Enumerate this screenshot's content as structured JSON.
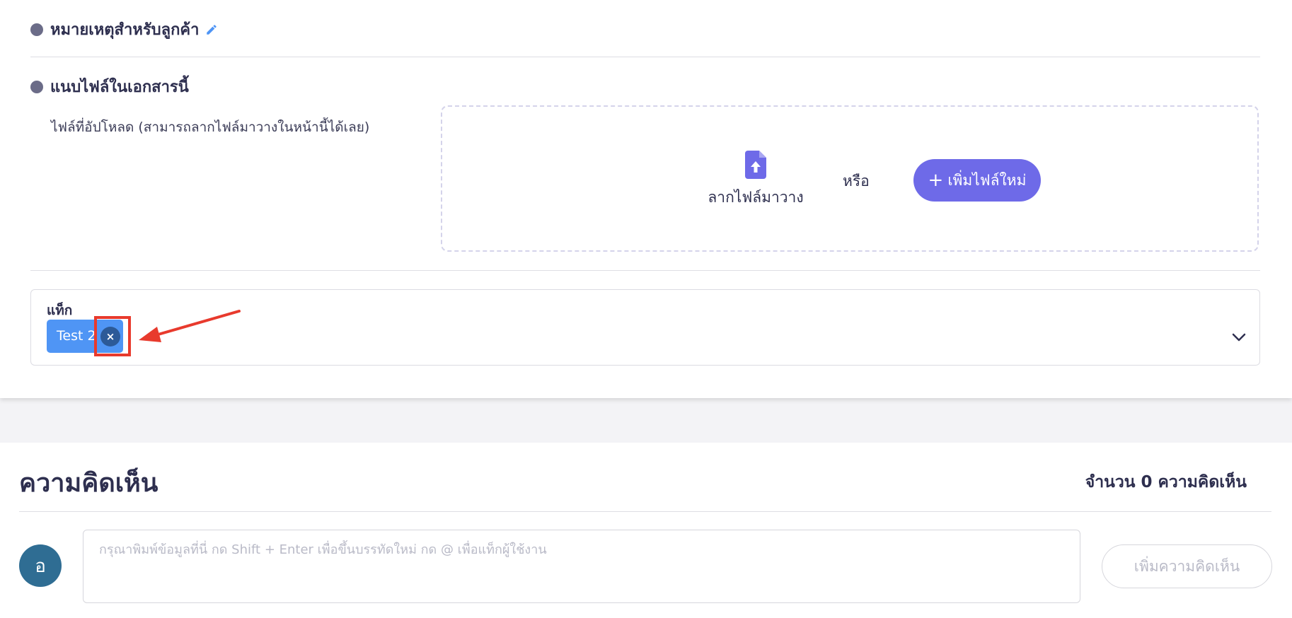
{
  "sections": {
    "customer_note": {
      "title": "หมายเหตุสำหรับลูกค้า"
    },
    "attachments": {
      "title": "แนบไฟล์ในเอกสารนี้",
      "hint": "ไฟล์ที่อัปโหลด (สามารถลากไฟล์มาวางในหน้านี้ได้เลย)",
      "drag_label": "ลากไฟล์มาวาง",
      "or_label": "หรือ",
      "add_file_label": "เพิ่มไฟล์ใหม่"
    },
    "tags": {
      "label": "แท็ก",
      "items": [
        {
          "label": "Test 2"
        }
      ]
    }
  },
  "comments": {
    "title": "ความคิดเห็น",
    "count_text": "จำนวน 0 ความคิดเห็น",
    "avatar_initial": "อ",
    "input_placeholder": "กรุณาพิมพ์ข้อมูลที่นี่ กด Shift + Enter เพื่อขึ้นบรรทัดใหม่ กด @ เพื่อแท็กผู้ใช้งาน",
    "submit_label": "เพิ่มความคิดเห็น"
  },
  "icons": {
    "edit": "pencil-icon",
    "upload": "file-upload-icon",
    "remove_tag": "close-icon",
    "dropdown": "chevron-down-icon",
    "annotation": "arrow-icon"
  },
  "colors": {
    "primary": "#6e6ae8",
    "tag": "#4f95f5",
    "tag_remove": "#2c5a98",
    "annotation": "#e83a2d",
    "avatar": "#2f6d93",
    "text": "#2e2f4f"
  }
}
